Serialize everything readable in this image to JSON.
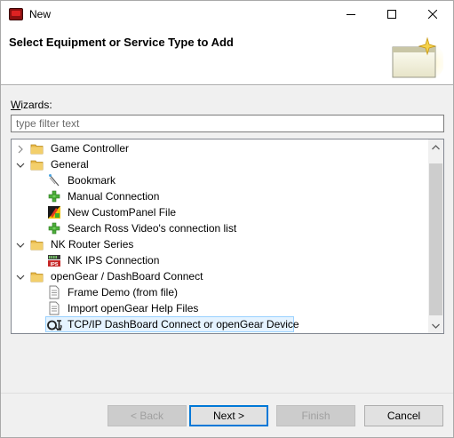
{
  "window": {
    "title": "New"
  },
  "banner": {
    "title": "Select Equipment or Service Type to Add"
  },
  "wizards": {
    "label_mnemonic": "W",
    "label_rest": "izards:",
    "filter_placeholder": "type filter text"
  },
  "tree": {
    "items": [
      {
        "label": "Game Controller",
        "level": 0,
        "expanded": false,
        "icon": "folder-icon"
      },
      {
        "label": "General",
        "level": 0,
        "expanded": true,
        "icon": "folder-icon"
      },
      {
        "label": "Bookmark",
        "level": 1,
        "icon": "bookmark-icon"
      },
      {
        "label": "Manual Connection",
        "level": 1,
        "icon": "plus-icon"
      },
      {
        "label": "New CustomPanel File",
        "level": 1,
        "icon": "custompanel-icon"
      },
      {
        "label": "Search Ross Video's connection list",
        "level": 1,
        "icon": "plus-icon"
      },
      {
        "label": "NK Router Series",
        "level": 0,
        "expanded": true,
        "icon": "folder-icon"
      },
      {
        "label": "NK IPS Connection",
        "level": 1,
        "icon": "ips-icon"
      },
      {
        "label": "openGear / DashBoard Connect",
        "level": 0,
        "expanded": true,
        "icon": "folder-icon"
      },
      {
        "label": "Frame Demo (from file)",
        "level": 1,
        "icon": "document-icon"
      },
      {
        "label": "Import openGear Help Files",
        "level": 1,
        "icon": "document-icon"
      },
      {
        "label": "TCP/IP DashBoard Connect or openGear Device",
        "level": 1,
        "icon": "opengear-icon",
        "selected": true
      }
    ]
  },
  "buttons": {
    "back": "< Back",
    "next": "Next >",
    "finish": "Finish",
    "cancel": "Cancel"
  },
  "colors": {
    "selection_bg": "#e5f3ff",
    "selection_border": "#99d1ff",
    "default_button_border": "#0078d7",
    "folder": "#e8b84a"
  }
}
